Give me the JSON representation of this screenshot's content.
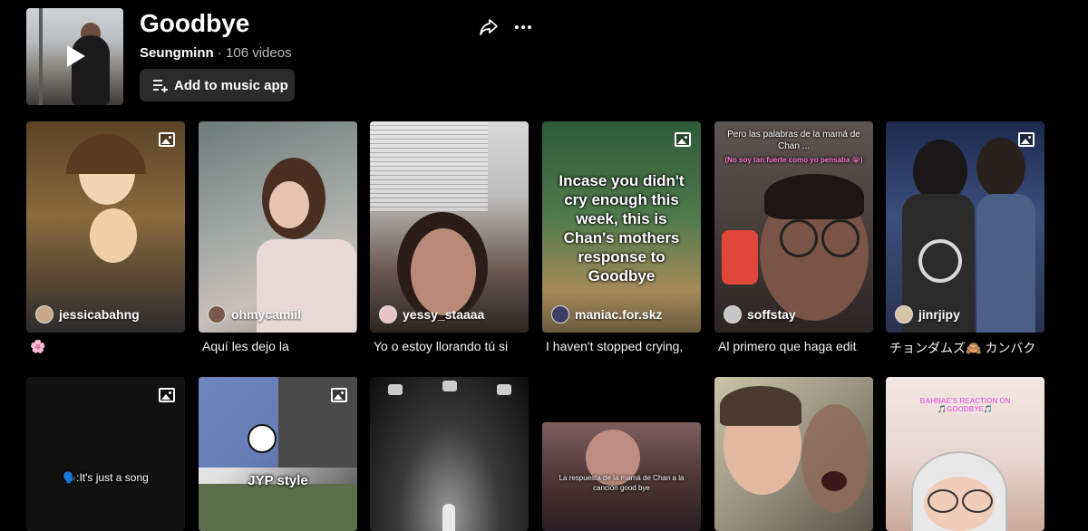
{
  "playlist": {
    "title": "Goodbye",
    "author": "Seungminn",
    "separator": "·",
    "video_count": "106 videos",
    "add_to_music_label": "Add to music app"
  },
  "videos_row1": [
    {
      "creator": "jessicabahng",
      "caption": "🌸",
      "is_photo": true
    },
    {
      "creator": "ohmycamiil",
      "caption": "Aquí les dejo la",
      "is_photo": false
    },
    {
      "creator": "yessy_staaaa",
      "caption": "Yo o estoy llorando tú si",
      "is_photo": false
    },
    {
      "creator": "maniac.for.skz",
      "caption": "I haven't stopped crying,",
      "is_photo": true,
      "overlay": "Incase you didn't cry enough this week, this is Chan's mothers response to Goodbye"
    },
    {
      "creator": "soffstay",
      "caption": "Al primero que haga edit",
      "is_photo": false,
      "overlay": "Pero las palabras de la mamá de Chan ...",
      "overlay_sub": "(No soy tan fuerte como yo pensaba 😭)"
    },
    {
      "creator": "jinrjipy",
      "caption": "チョンダムズ🙈 カンバク",
      "is_photo": true
    }
  ],
  "videos_row2": [
    {
      "overlay": "🗣️:It's just a song",
      "is_photo": true
    },
    {
      "overlay": "JYP style",
      "is_photo": true
    },
    {
      "overlay": "",
      "is_photo": false
    },
    {
      "overlay": "La respuesta de la mamá de Chan a la canción good bye",
      "is_photo": false
    },
    {
      "overlay": "",
      "is_photo": false
    },
    {
      "overlay": "BAHNAE'S REACTION ON 🎵GOODBYE🎵",
      "is_photo": false
    }
  ]
}
